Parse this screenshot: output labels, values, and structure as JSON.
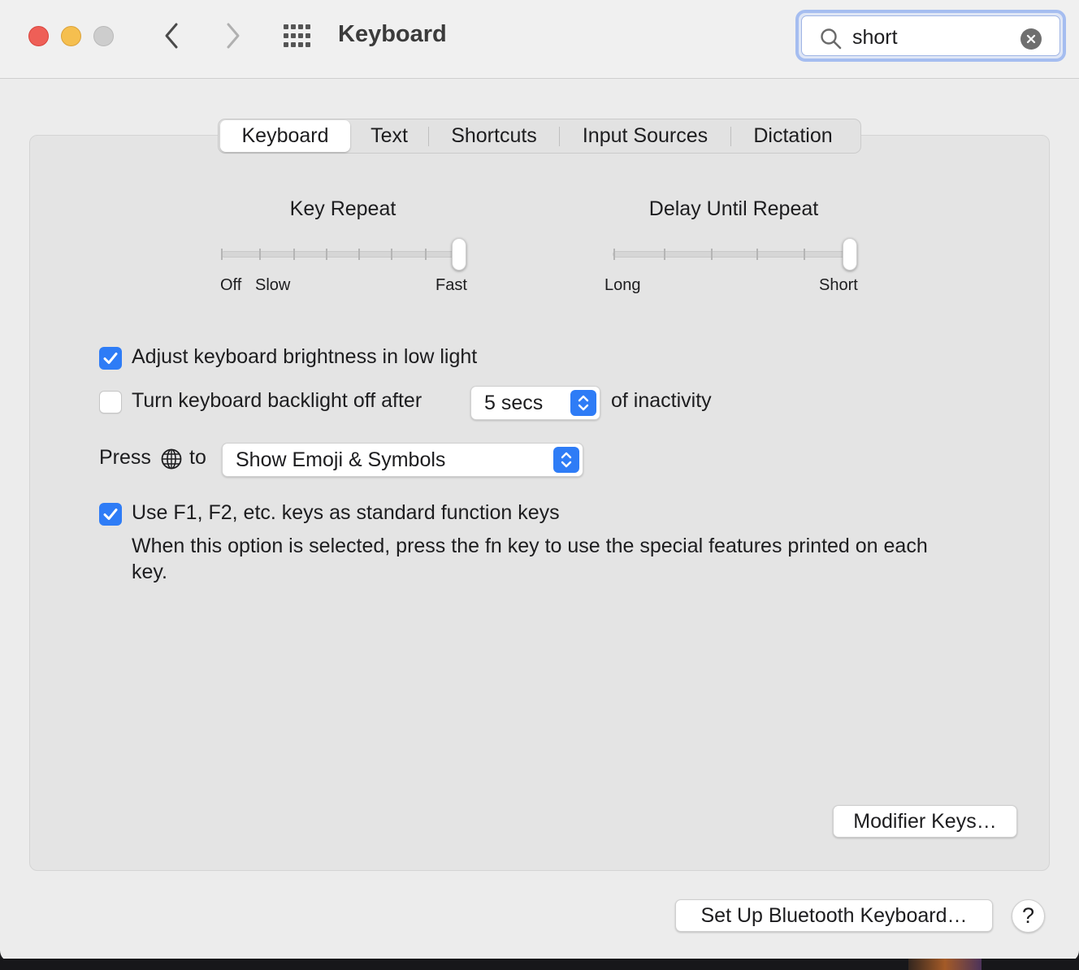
{
  "window": {
    "title": "Keyboard"
  },
  "search": {
    "value": "short",
    "placeholder": "Search"
  },
  "tabs": [
    {
      "label": "Keyboard",
      "active": true
    },
    {
      "label": "Text",
      "active": false
    },
    {
      "label": "Shortcuts",
      "active": false
    },
    {
      "label": "Input Sources",
      "active": false
    },
    {
      "label": "Dictation",
      "active": false
    }
  ],
  "key_repeat": {
    "title": "Key Repeat",
    "label_off": "Off",
    "label_slow": "Slow",
    "label_fast": "Fast",
    "level": 1.0
  },
  "delay_until_repeat": {
    "title": "Delay Until Repeat",
    "label_long": "Long",
    "label_short": "Short",
    "level": 1.0
  },
  "brightness": {
    "label": "Adjust keyboard brightness in low light",
    "checked": true
  },
  "backlight": {
    "label": "Turn keyboard backlight off after",
    "checked": false,
    "value": "5 secs",
    "suffix": "of inactivity"
  },
  "press_globe": {
    "prefix": "Press",
    "suffix": "to",
    "value": "Show Emoji & Symbols",
    "icon": "globe-icon"
  },
  "function_keys": {
    "label": "Use F1, F2, etc. keys as standard function keys",
    "checked": true,
    "description": "When this option is selected, press the fn key to use the special features printed on each key."
  },
  "buttons": {
    "modifier_keys": "Modifier Keys…",
    "bluetooth": "Set Up Bluetooth Keyboard…",
    "help": "?"
  },
  "colors": {
    "accent": "#2e7cf6",
    "close": "#ee5f57",
    "minimize": "#f5bf4f",
    "maximize": "#cdcdcd"
  }
}
